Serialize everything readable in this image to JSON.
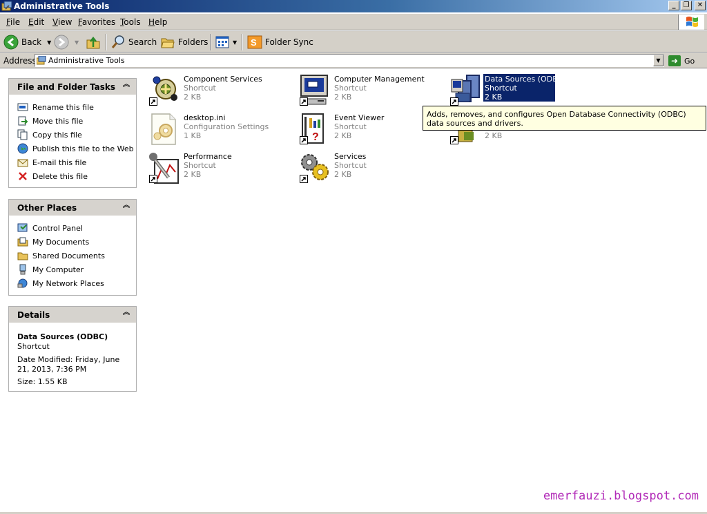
{
  "window": {
    "title": "Administrative Tools",
    "buttons": {
      "minimize": "_",
      "maximize": "❐",
      "close": "✕"
    }
  },
  "menu": {
    "items": [
      {
        "key": "F",
        "rest": "ile"
      },
      {
        "key": "E",
        "rest": "dit"
      },
      {
        "key": "V",
        "rest": "iew"
      },
      {
        "key": "F",
        "rest": "avorites"
      },
      {
        "key": "T",
        "rest": "ools"
      },
      {
        "key": "H",
        "rest": "elp"
      }
    ]
  },
  "toolbar": {
    "back": "Back",
    "search": "Search",
    "folders": "Folders",
    "folder_sync": "Folder Sync"
  },
  "address": {
    "label": "Address",
    "value": "Administrative Tools",
    "go": "Go"
  },
  "tasks": {
    "title": "File and Folder Tasks",
    "items": [
      {
        "label": "Rename this file",
        "icon": "rename-icon"
      },
      {
        "label": "Move this file",
        "icon": "move-icon"
      },
      {
        "label": "Copy this file",
        "icon": "copy-icon"
      },
      {
        "label": "Publish this file to the Web",
        "icon": "globe-icon"
      },
      {
        "label": "E-mail this file",
        "icon": "email-icon"
      },
      {
        "label": "Delete this file",
        "icon": "delete-icon"
      }
    ]
  },
  "places": {
    "title": "Other Places",
    "items": [
      {
        "label": "Control Panel",
        "icon": "control-panel-icon"
      },
      {
        "label": "My Documents",
        "icon": "my-documents-icon"
      },
      {
        "label": "Shared Documents",
        "icon": "folder-icon"
      },
      {
        "label": "My Computer",
        "icon": "computer-icon"
      },
      {
        "label": "My Network Places",
        "icon": "network-icon"
      }
    ]
  },
  "details": {
    "title": "Details",
    "name": "Data Sources (ODBC)",
    "type": "Shortcut",
    "modified": "Date Modified: Friday, June 21, 2013, 7:36 PM",
    "size": "Size: 1.55 KB"
  },
  "files": [
    {
      "name": "Component Services",
      "type": "Shortcut",
      "size": "2 KB",
      "icon": "component-services-icon"
    },
    {
      "name": "Computer Management",
      "type": "Shortcut",
      "size": "2 KB",
      "icon": "computer-management-icon"
    },
    {
      "name": "Data Sources (ODBC)",
      "type": "Shortcut",
      "size": "2 KB",
      "icon": "data-sources-icon",
      "selected": true
    },
    {
      "name": "desktop.ini",
      "type": "Configuration Settings",
      "size": "1 KB",
      "icon": "config-file-icon"
    },
    {
      "name": "Event Viewer",
      "type": "Shortcut",
      "size": "2 KB",
      "icon": "event-viewer-icon"
    },
    {
      "name": "",
      "type": "",
      "size": "2 KB",
      "icon": "shortcut-icon"
    },
    {
      "name": "Performance",
      "type": "Shortcut",
      "size": "2 KB",
      "icon": "performance-icon"
    },
    {
      "name": "Services",
      "type": "Shortcut",
      "size": "2 KB",
      "icon": "services-icon"
    }
  ],
  "tooltip": "Adds, removes, and configures Open Database Connectivity (ODBC) data sources and drivers.",
  "watermark": "emerfauzi.blogspot.com"
}
